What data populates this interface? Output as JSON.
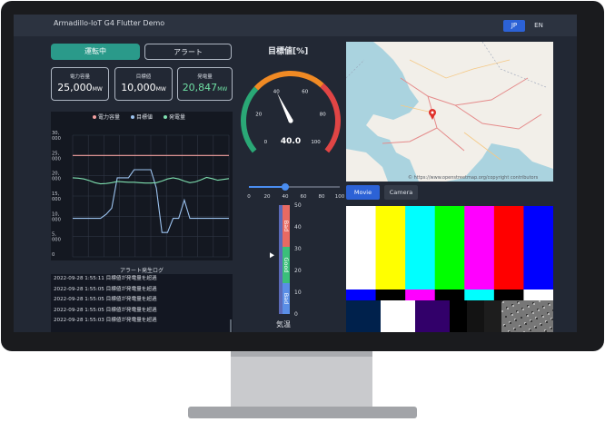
{
  "app": {
    "title": "Armadillo-IoT G4 Flutter Demo"
  },
  "lang": {
    "jp": "JP",
    "en": "EN"
  },
  "tabs": {
    "run": "運転中",
    "alert": "アラート"
  },
  "cards": [
    {
      "label": "電力容量",
      "value": "25,000",
      "unit": "MW"
    },
    {
      "label": "目標値",
      "value": "10,000",
      "unit": "MW"
    },
    {
      "label": "発電量",
      "value": "20,847",
      "unit": "MW"
    }
  ],
  "chart_data": {
    "type": "line",
    "legend": [
      "電力容量",
      "目標値",
      "発電量"
    ],
    "y_ticks": [
      "30,000",
      "25,000",
      "20,000",
      "15,000",
      "10,000",
      "5,000",
      "0"
    ],
    "ylim": [
      0,
      30000
    ],
    "colors": {
      "capacity": "#f4a0a0",
      "target": "#9cc3f0",
      "generation": "#7fe0b0"
    },
    "series": [
      {
        "name": "電力容量",
        "values": [
          25000,
          25000,
          25000,
          25000,
          25000,
          25000,
          25000,
          25000,
          25000,
          25000,
          25000,
          25000,
          25000,
          25000,
          25000,
          25000,
          25000,
          25000,
          25000,
          25000,
          25000,
          25000,
          25000,
          25000,
          25000,
          25000,
          25000,
          25000,
          25000
        ]
      },
      {
        "name": "目標値",
        "values": [
          9500,
          9500,
          9500,
          9500,
          9500,
          9500,
          10500,
          12000,
          19500,
          19500,
          19500,
          21500,
          21500,
          21500,
          21500,
          17000,
          6000,
          6000,
          9500,
          9500,
          14000,
          9500,
          9500,
          9500,
          9500,
          9500,
          9500,
          9500,
          9500
        ]
      },
      {
        "name": "発電量",
        "values": [
          19500,
          19400,
          19200,
          18800,
          18300,
          18000,
          18100,
          18300,
          18600,
          18500,
          18400,
          18400,
          18300,
          18200,
          18200,
          18300,
          18700,
          19200,
          19500,
          19200,
          18700,
          18300,
          18500,
          19000,
          19600,
          19300,
          18900,
          19100,
          19300
        ]
      }
    ]
  },
  "alert_log": {
    "title": "アラート発生ログ",
    "rows": [
      "2022-09-28 1:55:11 目標値が発電量を超過",
      "2022-09-28 1:55:05 目標値が発電量を超過",
      "2022-09-28 1:55:05 目標値が発電量を超過",
      "2022-09-28 1:55:05 目標値が発電量を超過",
      "2022-09-28 1:55:03 目標値が発電量を超過"
    ]
  },
  "gauge": {
    "title": "目標値[%]",
    "value": 40,
    "value_label": "40.0",
    "ticks": [
      "0",
      "20",
      "40",
      "60",
      "80",
      "100"
    ]
  },
  "slider": {
    "value": 40,
    "ticks": [
      "0",
      "20",
      "40",
      "60",
      "80",
      "100"
    ]
  },
  "temperature": {
    "label": "気温",
    "zones": [
      "Bad",
      "Good",
      "Bad"
    ],
    "ticks": [
      "50",
      "40",
      "30",
      "20",
      "10",
      "0"
    ],
    "marker_value": 27
  },
  "map": {
    "copyright": "© https://www.openstreetmap.org/copyright contributors"
  },
  "video": {
    "movie": "Movie",
    "camera": "Camera"
  }
}
